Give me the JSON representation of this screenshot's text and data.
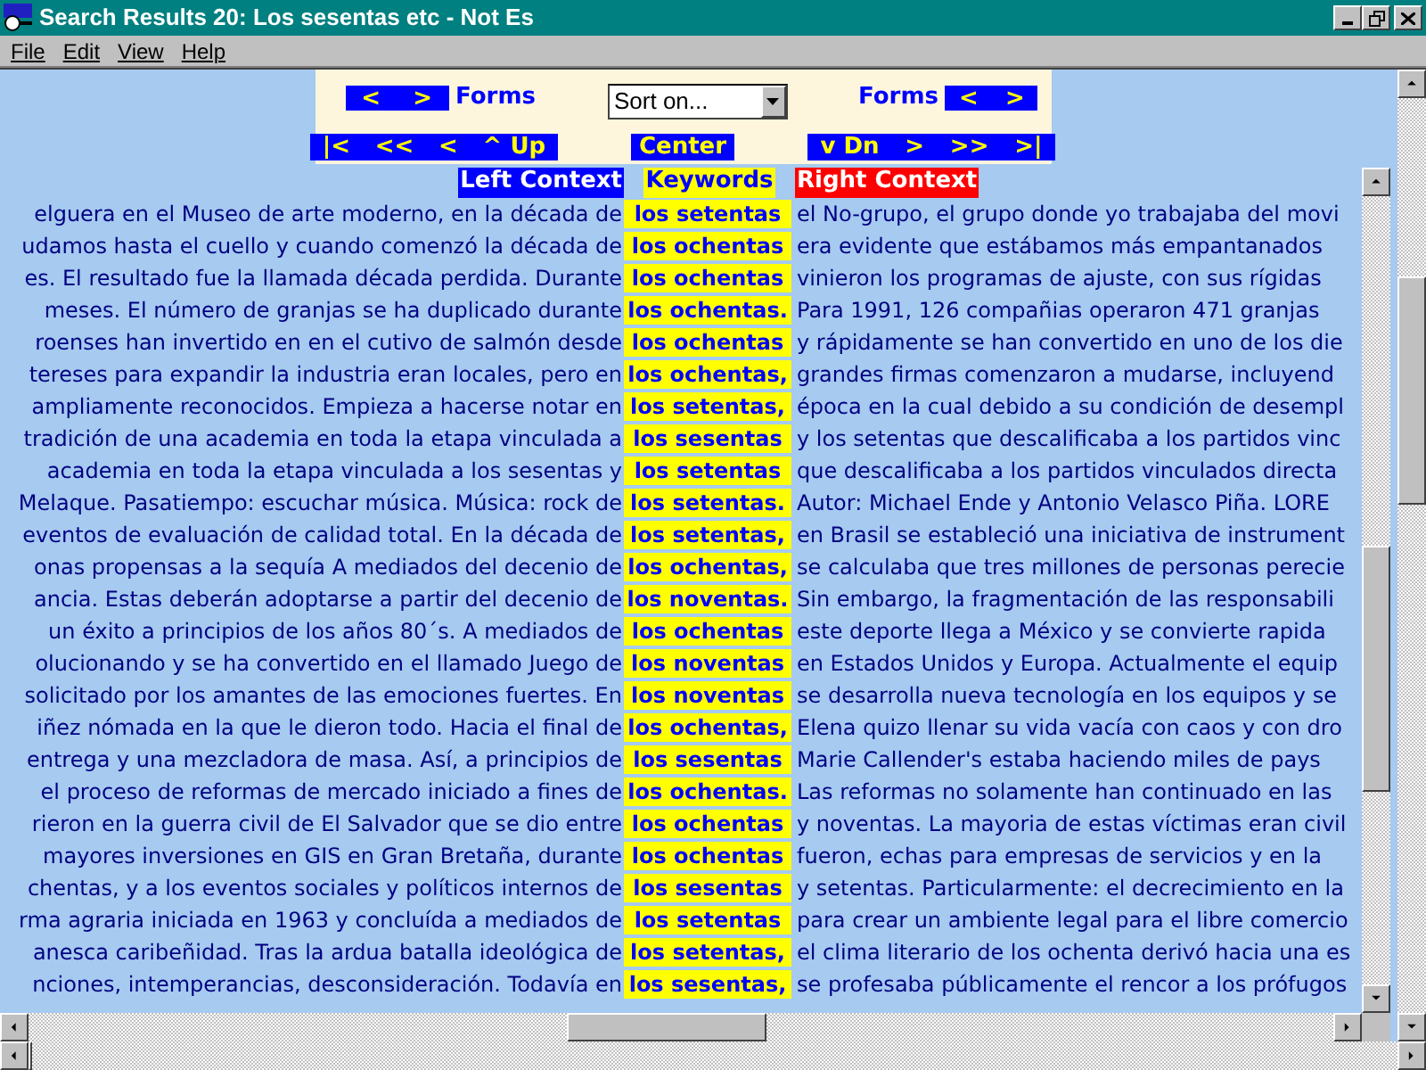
{
  "window": {
    "title": "Search Results 20:  Los sesentas etc - Not Es"
  },
  "menu": [
    "File",
    "Edit",
    "View",
    "Help"
  ],
  "controls": {
    "forms_left": {
      "buttons": [
        "<",
        ">"
      ],
      "label": "Forms"
    },
    "sort": {
      "value": "Sort on..."
    },
    "forms_right": {
      "label": "Forms",
      "buttons": [
        "<",
        ">"
      ]
    },
    "nav_up": [
      "|<",
      "<<",
      "<",
      "^ Up"
    ],
    "center": "Center",
    "nav_down": [
      "v Dn",
      ">",
      ">>",
      ">|"
    ]
  },
  "columns": [
    "Left Context",
    "Keywords",
    "Right Context"
  ],
  "rows": [
    {
      "left": "elguera en el Museo de arte moderno, en la década de",
      "keyword": "los setentas",
      "right": "el No-grupo, el grupo donde yo trabajaba del movi"
    },
    {
      "left": "udamos hasta el cuello y cuando comenzó la década de",
      "keyword": "los ochentas",
      "right": "era evidente que estábamos más empantanados"
    },
    {
      "left": "es. El resultado fue la llamada década perdida. Durante",
      "keyword": "los ochentas",
      "right": "vinieron los programas de ajuste, con sus rígidas"
    },
    {
      "left": "meses. El número de granjas se ha duplicado durante",
      "keyword": "los ochentas.",
      "right": "Para 1991, 126 compañias operaron 471 granjas"
    },
    {
      "left": "roenses han invertido en en el cutivo de salmón desde",
      "keyword": "los ochentas",
      "right": "y rápidamente se han convertido en uno de los die"
    },
    {
      "left": "tereses para expandir la industria eran locales, pero en",
      "keyword": "los ochentas,",
      "right": "grandes firmas comenzaron a mudarse, incluyend"
    },
    {
      "left": "ampliamente reconocidos. Empieza a hacerse notar en",
      "keyword": "los setentas,",
      "right": "época en la cual debido a su condición de desempl"
    },
    {
      "left": "tradición de una academia en toda la etapa vinculada a",
      "keyword": "los sesentas",
      "right": "y los setentas que descalificaba a los partidos vinc"
    },
    {
      "left": "academia en toda la etapa vinculada a los sesentas y",
      "keyword": "los setentas",
      "right": "que descalificaba a los partidos vinculados directa"
    },
    {
      "left": "Melaque. Pasatiempo: escuchar música. Música: rock de",
      "keyword": "los setentas.",
      "right": "Autor: Michael Ende y Antonio Velasco Piña. LORE"
    },
    {
      "left": "eventos de evaluación de calidad total. En la década de",
      "keyword": "los setentas,",
      "right": "en Brasil se estableció una iniciativa de instrument"
    },
    {
      "left": "onas propensas a la sequía A mediados del decenio de",
      "keyword": "los ochentas,",
      "right": "se calculaba que tres millones de personas perecie"
    },
    {
      "left": "ancia. Estas deberán adoptarse a partir del decenio de",
      "keyword": "los noventas.",
      "right": "Sin embargo, la fragmentación de las responsabili"
    },
    {
      "left": "un éxito a principios de los años 80´s. A mediados de",
      "keyword": "los ochentas",
      "right": "este deporte llega a México y se convierte rapida"
    },
    {
      "left": "olucionando y se ha convertido en el llamado Juego de",
      "keyword": "los noventas",
      "right": "en Estados Unidos y Europa. Actualmente el equip"
    },
    {
      "left": "solicitado por los amantes de las emociones fuertes. En",
      "keyword": "los noventas",
      "right": "se desarrolla nueva tecnología en los equipos y se"
    },
    {
      "left": "iñez nómada en la que le dieron todo. Hacia el final de",
      "keyword": "los ochentas,",
      "right": "Elena quizo llenar su vida vacía con caos y con dro"
    },
    {
      "left": "entrega y una mezcladora de masa. Así, a principios de",
      "keyword": "los sesentas",
      "right": "Marie Callender's estaba haciendo miles de pays"
    },
    {
      "left": "el proceso de reformas de mercado iniciado a fines de",
      "keyword": "los ochentas.",
      "right": "Las reformas no solamente han continuado en las"
    },
    {
      "left": "rieron en la guerra civil de El Salvador que se dio entre",
      "keyword": "los ochentas",
      "right": "y noventas. La mayoria de estas víctimas eran civil"
    },
    {
      "left": "mayores inversiones en GIS en Gran Bretaña, durante",
      "keyword": "los ochentas",
      "right": "fueron, echas para empresas de servicios y en la"
    },
    {
      "left": "chentas, y a los eventos sociales y políticos internos de",
      "keyword": "los sesentas",
      "right": "y setentas. Particularmente: el decrecimiento en la"
    },
    {
      "left": "rma agraria iniciada en 1963 y concluída a mediados de",
      "keyword": "los setentas",
      "right": "para crear un ambiente legal para el libre comercio"
    },
    {
      "left": "anesca caribeñidad. Tras la ardua batalla ideológica de",
      "keyword": "los setentas,",
      "right": "el clima literario de los ochenta derivó hacia una es"
    },
    {
      "left": "nciones, intemperancias, desconsideración. Todavía en",
      "keyword": "los sesentas,",
      "right": "se profesaba públicamente el rencor a los prófugos"
    }
  ]
}
